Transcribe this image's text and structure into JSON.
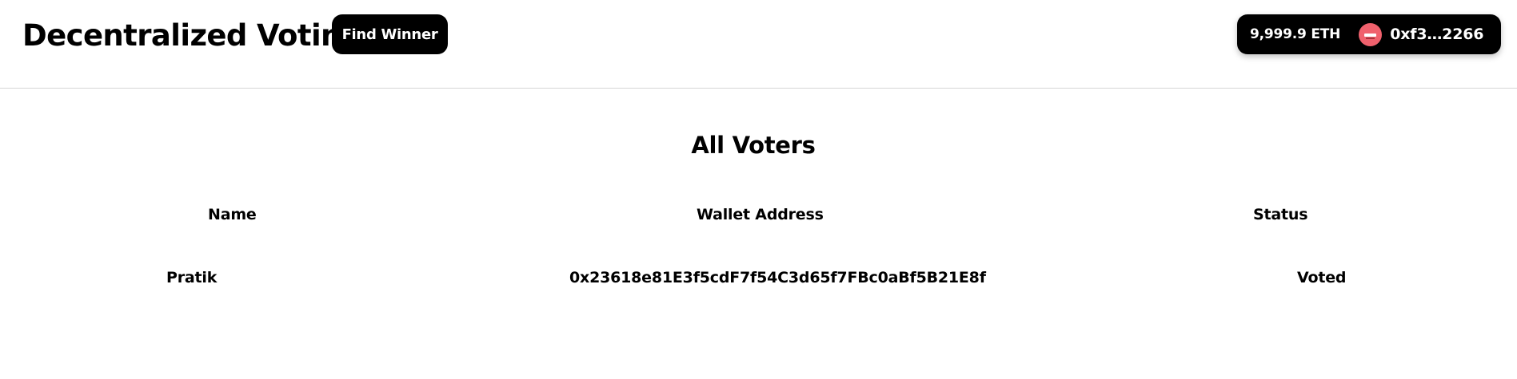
{
  "header": {
    "app_title": "Decentralized Voting",
    "find_winner_label": "Find Winner",
    "wallet": {
      "balance": "9,999.9 ETH",
      "account": "0xf3…2266",
      "avatar_color": "#f0616d",
      "dropdown_icon": "chevron-down-icon"
    }
  },
  "main": {
    "section_title": "All Voters",
    "table": {
      "columns": [
        "Name",
        "Wallet Address",
        "Status"
      ],
      "rows": [
        {
          "name": "Pratik",
          "wallet_address": "0x23618e81E3f5cdF7f54C3d65f7FBc0aBf5B21E8f",
          "status": "Voted"
        }
      ]
    }
  }
}
